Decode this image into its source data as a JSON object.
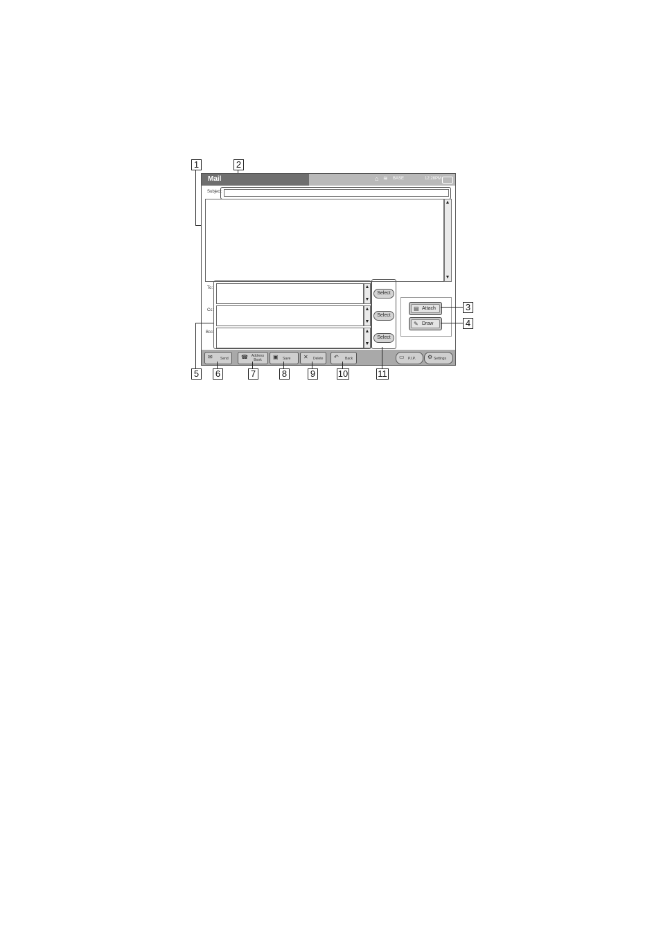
{
  "window": {
    "title": "Mail"
  },
  "status": {
    "base": "BASE",
    "time": "12:28PM"
  },
  "compose": {
    "subject_label": "Subject:",
    "to_label": "To:",
    "cc_label": "Cc:",
    "bcc_label": "Bcc:",
    "select_label": "Select"
  },
  "side": {
    "attach_label": "Attach",
    "draw_label": "Draw"
  },
  "toolbar": {
    "send": "Send",
    "address_book": "Address Book",
    "save": "Save",
    "delete": "Delete",
    "back": "Back",
    "pip": "P.I.P.",
    "settings": "Settings"
  },
  "callouts": {
    "c1": "1",
    "c2": "2",
    "c3": "3",
    "c4": "4",
    "c5": "5",
    "c6": "6",
    "c7": "7",
    "c8": "8",
    "c9": "9",
    "c10": "10",
    "c11": "11"
  },
  "icons": {
    "home": "home-icon",
    "wireless": "wireless-icon",
    "battery": "battery-icon",
    "send": "send-icon",
    "address_book": "address-book-icon",
    "save": "save-icon",
    "delete": "delete-icon",
    "back": "back-icon",
    "pip": "pip-icon",
    "settings": "settings-icon",
    "attach": "attach-icon",
    "draw": "draw-icon"
  }
}
